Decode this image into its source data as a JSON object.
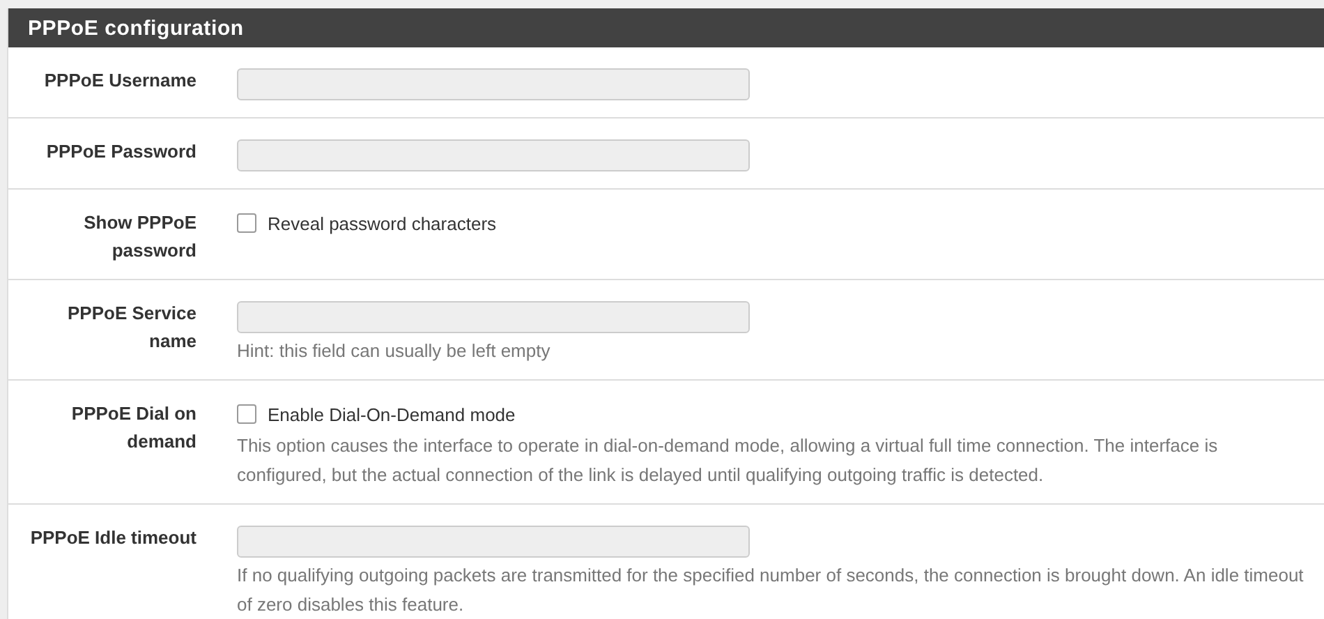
{
  "panel": {
    "title": "PPPoE configuration"
  },
  "rows": [
    {
      "label": "PPPoE Username",
      "kind": "text"
    },
    {
      "label": "PPPoE Password",
      "kind": "text"
    },
    {
      "label": "Show PPPoE password",
      "kind": "checkbox",
      "option": "Reveal password characters",
      "checked": false
    },
    {
      "label": "PPPoE Service name",
      "kind": "text",
      "hint": "Hint: this field can usually be left empty"
    },
    {
      "label": "PPPoE Dial on demand",
      "kind": "checkbox",
      "option": "Enable Dial-On-Demand mode",
      "checked": false,
      "hint": "This option causes the interface to operate in dial-on-demand mode, allowing a virtual full time connection. The interface is configured, but the actual connection of the link is delayed until qualifying outgoing traffic is detected."
    },
    {
      "label": "PPPoE Idle timeout",
      "kind": "text",
      "hint": "If no qualifying outgoing packets are transmitted for the specified number of seconds, the connection is brought down. An idle timeout of zero disables this feature."
    }
  ]
}
